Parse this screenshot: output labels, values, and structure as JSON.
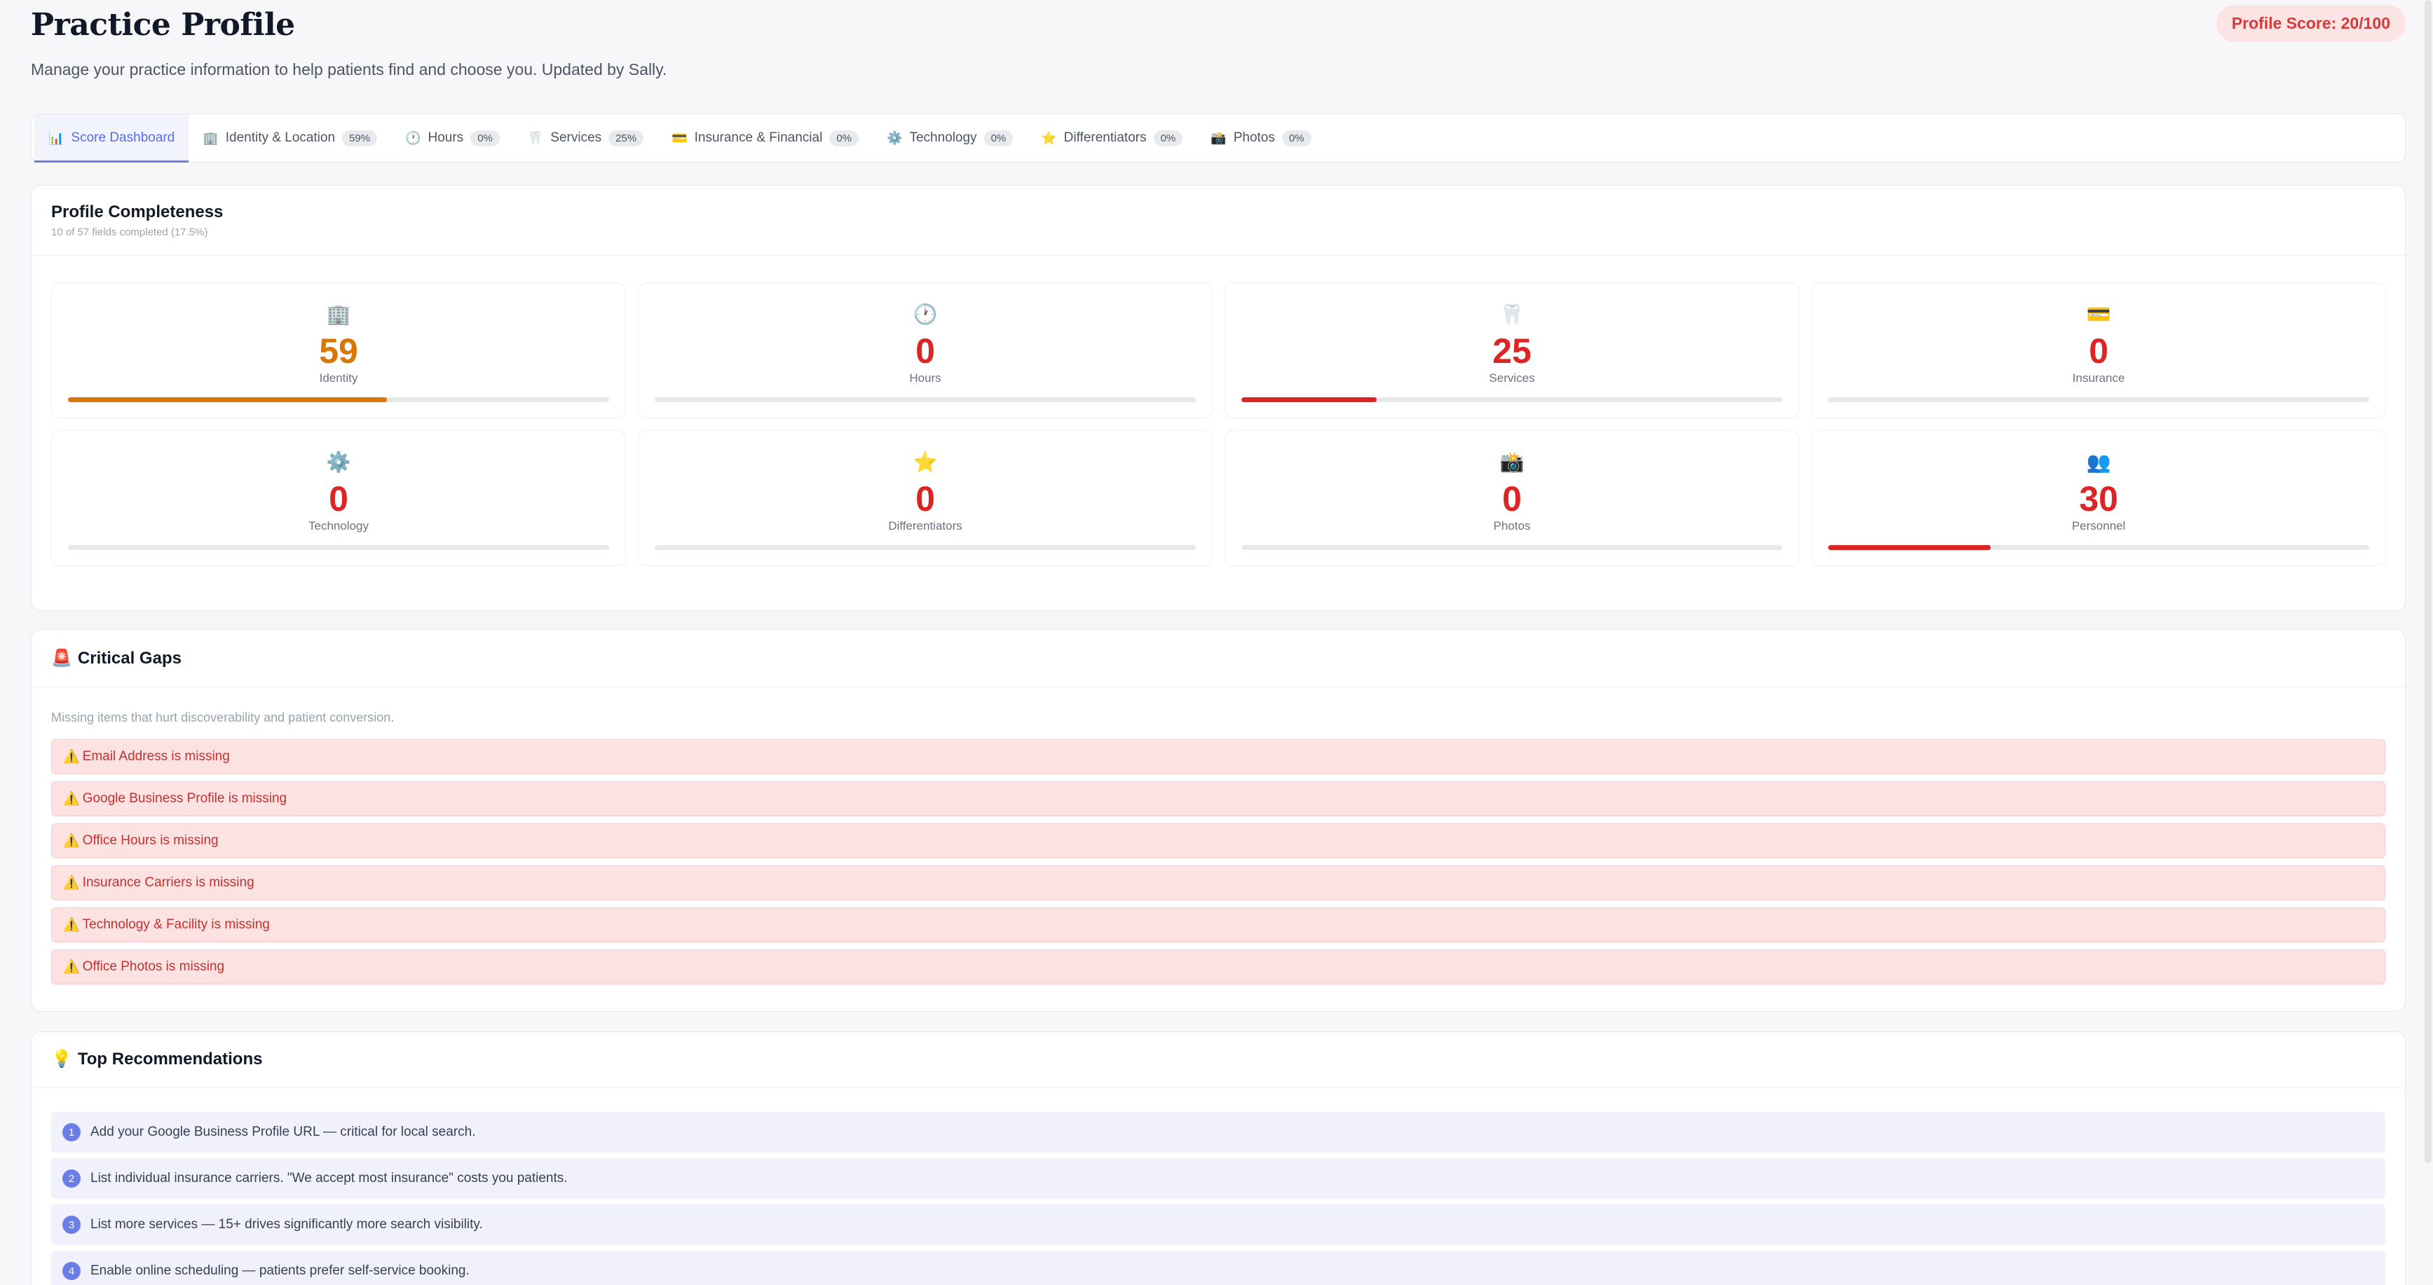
{
  "header": {
    "title": "Practice Profile",
    "subtitle": "Manage your practice information to help patients find and choose you. Updated by Sally.",
    "score_label": "Profile Score: 20/100"
  },
  "tabs": [
    {
      "icon": "📊",
      "label": "Score Dashboard",
      "badge": ""
    },
    {
      "icon": "🏢",
      "label": "Identity & Location",
      "badge": "59%"
    },
    {
      "icon": "🕐",
      "label": "Hours",
      "badge": "0%"
    },
    {
      "icon": "🦷",
      "label": "Services",
      "badge": "25%"
    },
    {
      "icon": "💳",
      "label": "Insurance & Financial",
      "badge": "0%"
    },
    {
      "icon": "⚙️",
      "label": "Technology",
      "badge": "0%"
    },
    {
      "icon": "⭐",
      "label": "Differentiators",
      "badge": "0%"
    },
    {
      "icon": "📸",
      "label": "Photos",
      "badge": "0%"
    }
  ],
  "completeness": {
    "title": "Profile Completeness",
    "subtitle": "10 of 57 fields completed (17.5%)",
    "stats": [
      {
        "icon": "🏢",
        "value": "59",
        "label": "Identity",
        "percent": 59,
        "color": "#d97706"
      },
      {
        "icon": "🕐",
        "value": "0",
        "label": "Hours",
        "percent": 0,
        "color": "#dc2626"
      },
      {
        "icon": "🦷",
        "value": "25",
        "label": "Services",
        "percent": 25,
        "color": "#dc2626"
      },
      {
        "icon": "💳",
        "value": "0",
        "label": "Insurance",
        "percent": 0,
        "color": "#dc2626"
      },
      {
        "icon": "⚙️",
        "value": "0",
        "label": "Technology",
        "percent": 0,
        "color": "#dc2626"
      },
      {
        "icon": "⭐",
        "value": "0",
        "label": "Differentiators",
        "percent": 0,
        "color": "#dc2626"
      },
      {
        "icon": "📸",
        "value": "0",
        "label": "Photos",
        "percent": 0,
        "color": "#dc2626"
      },
      {
        "icon": "👥",
        "value": "30",
        "label": "Personnel",
        "percent": 30,
        "color": "#dc2626"
      }
    ]
  },
  "gaps": {
    "icon": "🚨",
    "title": "Critical Gaps",
    "note": "Missing items that hurt discoverability and patient conversion.",
    "items": [
      "Email Address is missing",
      "Google Business Profile is missing",
      "Office Hours is missing",
      "Insurance Carriers is missing",
      "Technology & Facility is missing",
      "Office Photos is missing"
    ]
  },
  "recommendations": {
    "icon": "💡",
    "title": "Top Recommendations",
    "items": [
      {
        "num": "1",
        "text": "Add your Google Business Profile URL — critical for local search."
      },
      {
        "num": "2",
        "text": "List individual insurance carriers. \"We accept most insurance\" costs you patients."
      },
      {
        "num": "3",
        "text": "List more services — 15+ drives significantly more search visibility."
      },
      {
        "num": "4",
        "text": "Enable online scheduling — patients prefer self-service booking."
      }
    ]
  },
  "colors": {
    "accent": "#6b7de6",
    "danger": "#dc2626",
    "warning": "#d97706"
  }
}
